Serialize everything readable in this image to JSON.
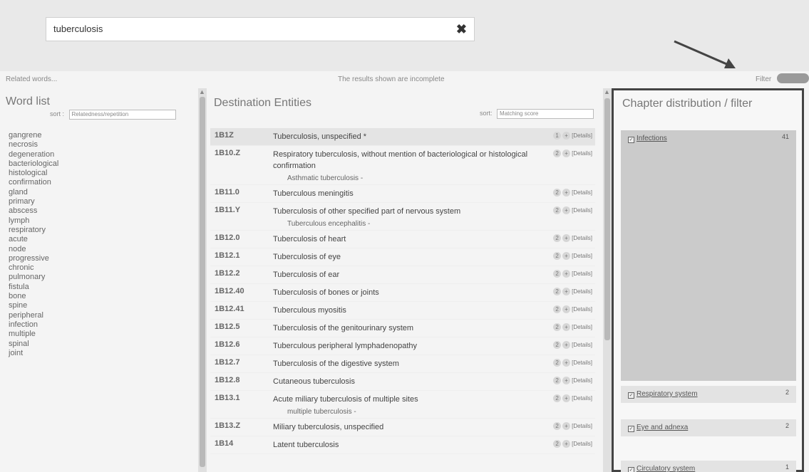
{
  "search": {
    "value": "tuberculosis",
    "clear_icon": "close-icon"
  },
  "meta": {
    "related_words": "Related words...",
    "incomplete_notice": "The results shown are incomplete",
    "filter_label": "Filter"
  },
  "word_list": {
    "title": "Word list",
    "sort_label": "sort :",
    "sort_value": "Relatedness/repetition",
    "words": [
      "gangrene",
      "necrosis",
      "degeneration",
      "bacteriological",
      "histological",
      "confirmation",
      "gland",
      "primary",
      "abscess",
      "lymph",
      "respiratory",
      "acute",
      "node",
      "progressive",
      "chronic",
      "pulmonary",
      "fistula",
      "bone",
      "spine",
      "peripheral",
      "infection",
      "multiple",
      "spinal",
      "joint"
    ]
  },
  "destination": {
    "title": "Destination Entities",
    "sort_label": "sort:",
    "sort_value": "Matching score",
    "rows": [
      {
        "code": "1B1Z",
        "title": "Tuberculosis, unspecified *",
        "sub": "",
        "btn_count": "1",
        "selected": true
      },
      {
        "code": "1B10.Z",
        "title": "Respiratory tuberculosis, without mention of bacteriological or histological confirmation",
        "sub": "Asthmatic tuberculosis -",
        "btn_count": "2"
      },
      {
        "code": "1B11.0",
        "title": "Tuberculous meningitis",
        "sub": "",
        "btn_count": "2"
      },
      {
        "code": "1B11.Y",
        "title": "Tuberculosis of other specified part of nervous system",
        "sub": "Tuberculous encephalitis -",
        "btn_count": "2"
      },
      {
        "code": "1B12.0",
        "title": "Tuberculosis of heart",
        "sub": "",
        "btn_count": "2"
      },
      {
        "code": "1B12.1",
        "title": "Tuberculosis of eye",
        "sub": "",
        "btn_count": "2"
      },
      {
        "code": "1B12.2",
        "title": "Tuberculosis of ear",
        "sub": "",
        "btn_count": "2"
      },
      {
        "code": "1B12.40",
        "title": "Tuberculosis of bones or joints",
        "sub": "",
        "btn_count": "2"
      },
      {
        "code": "1B12.41",
        "title": "Tuberculous myositis",
        "sub": "",
        "btn_count": "2"
      },
      {
        "code": "1B12.5",
        "title": "Tuberculosis of the genitourinary system",
        "sub": "",
        "btn_count": "2"
      },
      {
        "code": "1B12.6",
        "title": "Tuberculous peripheral lymphadenopathy",
        "sub": "",
        "btn_count": "2"
      },
      {
        "code": "1B12.7",
        "title": "Tuberculosis of the digestive system",
        "sub": "",
        "btn_count": "2"
      },
      {
        "code": "1B12.8",
        "title": "Cutaneous tuberculosis",
        "sub": "",
        "btn_count": "2"
      },
      {
        "code": "1B13.1",
        "title": "Acute miliary tuberculosis of multiple sites",
        "sub": "multiple tuberculosis -",
        "btn_count": "2"
      },
      {
        "code": "1B13.Z",
        "title": "Miliary tuberculosis, unspecified",
        "sub": "",
        "btn_count": "2"
      },
      {
        "code": "1B14",
        "title": "Latent tuberculosis",
        "sub": "",
        "btn_count": "2"
      }
    ],
    "details_label": "[Details]"
  },
  "chapter": {
    "title": "Chapter distribution / filter",
    "items": [
      {
        "label": "Infections",
        "count": "41",
        "checked": true
      },
      {
        "label": "Respiratory system",
        "count": "2",
        "checked": true
      },
      {
        "label": "Eye and adnexa",
        "count": "2",
        "checked": true
      },
      {
        "label": "Circulatory system",
        "count": "1",
        "checked": true
      }
    ]
  }
}
